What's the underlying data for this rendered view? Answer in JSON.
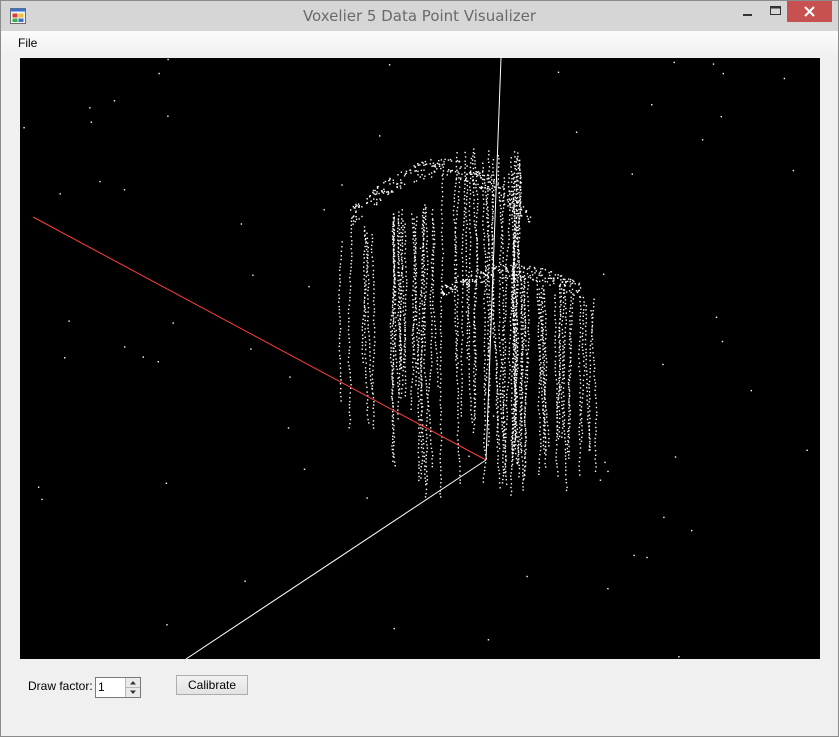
{
  "window": {
    "title": "Voxelier 5 Data Point Visualizer",
    "controls": [
      "minimize",
      "maximize",
      "close"
    ]
  },
  "menu": {
    "items": [
      {
        "label": "File"
      }
    ]
  },
  "viewport": {
    "background": "#000000",
    "axis_x_color": "#ff3030",
    "axis_color": "#ffffff",
    "point_color": "#ffffff"
  },
  "controls": {
    "draw_factor_label": "Draw factor:",
    "draw_factor_value": "1",
    "calibrate_label": "Calibrate"
  },
  "colors": {
    "titlebar": "#d6d6d6",
    "close_button": "#c75050",
    "window_bg": "#f0f0f0"
  }
}
